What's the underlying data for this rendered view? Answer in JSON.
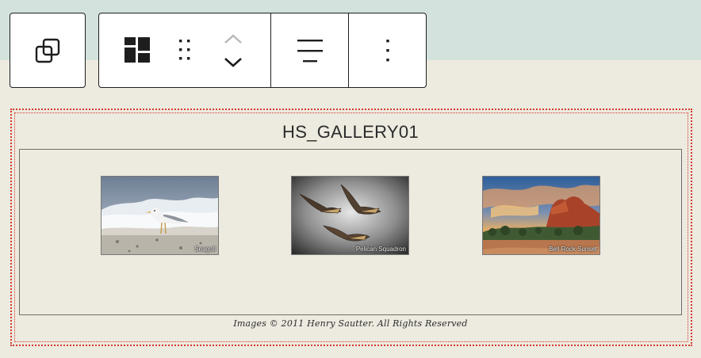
{
  "toolbar": {
    "transform_icon": "transform-duplicate-icon",
    "block_icon": "gallery-block-icon",
    "drag_icon": "drag-handle-icon",
    "move_up_icon": "chevron-up-icon",
    "move_down_icon": "chevron-down-icon",
    "align_icon": "align-center-icon",
    "more_icon": "more-vertical-icon"
  },
  "gallery": {
    "title": "HS_GALLERY01",
    "images": [
      {
        "caption": "Seagull",
        "icon": "seagull-photo"
      },
      {
        "caption": "Pelican Squadron",
        "icon": "pelicans-photo"
      },
      {
        "caption": "Bell Rock Sunset",
        "icon": "bell-rock-photo"
      }
    ],
    "copyright": "Images © 2011 Henry Sautter. All Rights Reserved"
  },
  "colors": {
    "page_bg": "#edeae0",
    "top_band": "#d3e2dc",
    "toolbar_border": "#1e1e1e",
    "block_outline": "#d33a2c"
  }
}
